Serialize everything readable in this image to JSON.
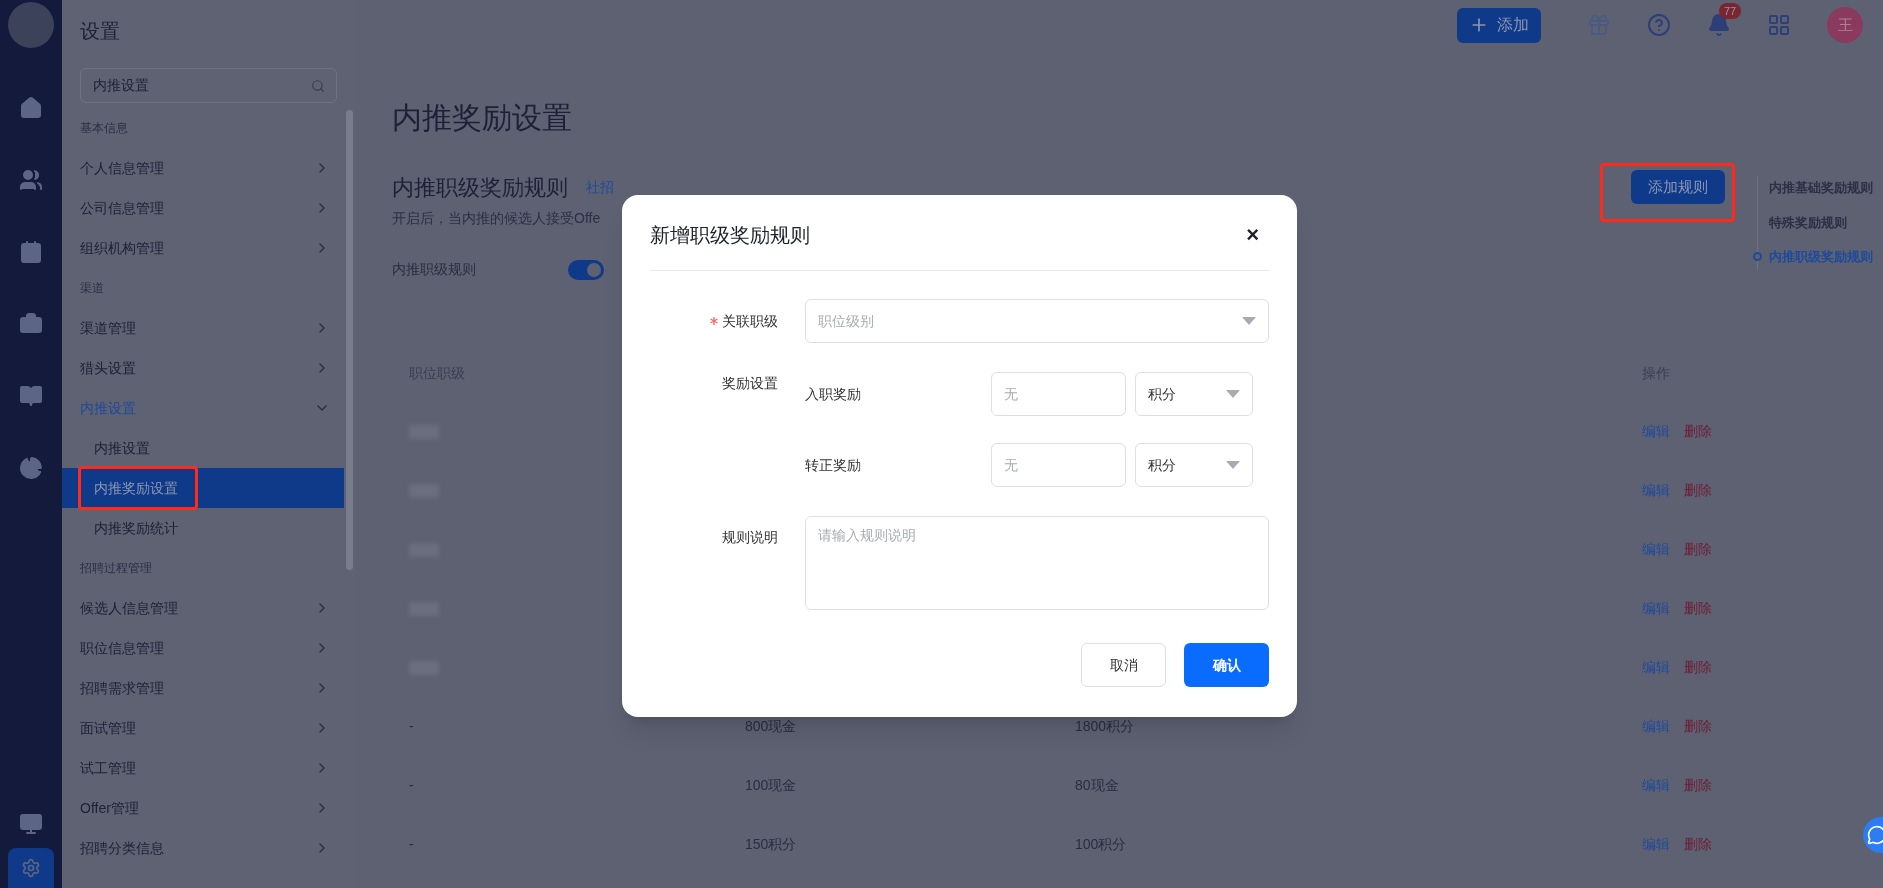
{
  "app": {
    "title": "设置"
  },
  "topbar": {
    "add_button": "添加",
    "notifications": "77",
    "avatar": "王"
  },
  "sidebar": {
    "search": {
      "value": "内推设置"
    },
    "groups": [
      {
        "label": "基本信息",
        "items": [
          {
            "label": "个人信息管理",
            "expanded": false,
            "selected": false
          },
          {
            "label": "公司信息管理",
            "expanded": false,
            "selected": false
          },
          {
            "label": "组织机构管理",
            "expanded": false,
            "selected": false
          }
        ]
      },
      {
        "label": "渠道",
        "items": [
          {
            "label": "渠道管理",
            "expanded": false,
            "selected": false
          },
          {
            "label": "猎头设置",
            "expanded": false,
            "selected": false
          },
          {
            "label": "内推设置",
            "expanded": true,
            "selected": true,
            "children": [
              {
                "label": "内推设置",
                "selected": false
              },
              {
                "label": "内推奖励设置",
                "selected": true
              },
              {
                "label": "内推奖励统计",
                "selected": false
              }
            ]
          }
        ]
      },
      {
        "label": "招聘过程管理",
        "items": [
          {
            "label": "候选人信息管理",
            "expanded": false,
            "selected": false
          },
          {
            "label": "职位信息管理",
            "expanded": false,
            "selected": false
          },
          {
            "label": "招聘需求管理",
            "expanded": false,
            "selected": false
          },
          {
            "label": "面试管理",
            "expanded": false,
            "selected": false
          },
          {
            "label": "试工管理",
            "expanded": false,
            "selected": false
          },
          {
            "label": "Offer管理",
            "expanded": false,
            "selected": false
          },
          {
            "label": "招聘分类信息",
            "expanded": false,
            "selected": false
          }
        ]
      }
    ]
  },
  "page": {
    "title": "内推奖励设置",
    "section_title": "内推职级奖励规则",
    "tag": "社招",
    "description": "开启后，当内推的候选人接受Offe",
    "toggle": {
      "label": "内推职级规则",
      "on": true
    },
    "add_rule_button": "添加规则"
  },
  "anchor_nav": [
    {
      "label": "内推基础奖励规则",
      "selected": false
    },
    {
      "label": "特殊奖励规则",
      "selected": false
    },
    {
      "label": "内推职级奖励规则",
      "selected": true
    }
  ],
  "table": {
    "columns": [
      "职位职级",
      "操作"
    ],
    "rows": [
      {
        "blurred": true,
        "actions": [
          "编辑",
          "删除"
        ]
      },
      {
        "blurred": true,
        "actions": [
          "编辑",
          "删除"
        ]
      },
      {
        "blurred": true,
        "actions": [
          "编辑",
          "删除"
        ]
      },
      {
        "blurred": true,
        "actions": [
          "编辑",
          "删除"
        ]
      },
      {
        "blurred": true,
        "actions": [
          "编辑",
          "删除"
        ]
      },
      {
        "blurred": false,
        "cells": [
          "-",
          "800现金",
          "1800积分"
        ],
        "actions": [
          "编辑",
          "删除"
        ]
      },
      {
        "blurred": false,
        "cells": [
          "-",
          "100现金",
          "80现金"
        ],
        "actions": [
          "编辑",
          "删除"
        ]
      },
      {
        "blurred": false,
        "cells": [
          "-",
          "150积分",
          "100积分"
        ],
        "actions": [
          "编辑",
          "删除"
        ]
      }
    ]
  },
  "dialog": {
    "title": "新增职级奖励规则",
    "close": "×",
    "level_field": {
      "label": "关联职级",
      "required": true,
      "placeholder": "职位级别"
    },
    "reward_label": "奖励设置",
    "rewards": [
      {
        "label": "入职奖励",
        "placeholder": "无",
        "unit": "积分"
      },
      {
        "label": "转正奖励",
        "placeholder": "无",
        "unit": "积分"
      }
    ],
    "description_field": {
      "label": "规则说明",
      "placeholder": "请输入规则说明"
    },
    "cancel": "取消",
    "confirm": "确认"
  }
}
